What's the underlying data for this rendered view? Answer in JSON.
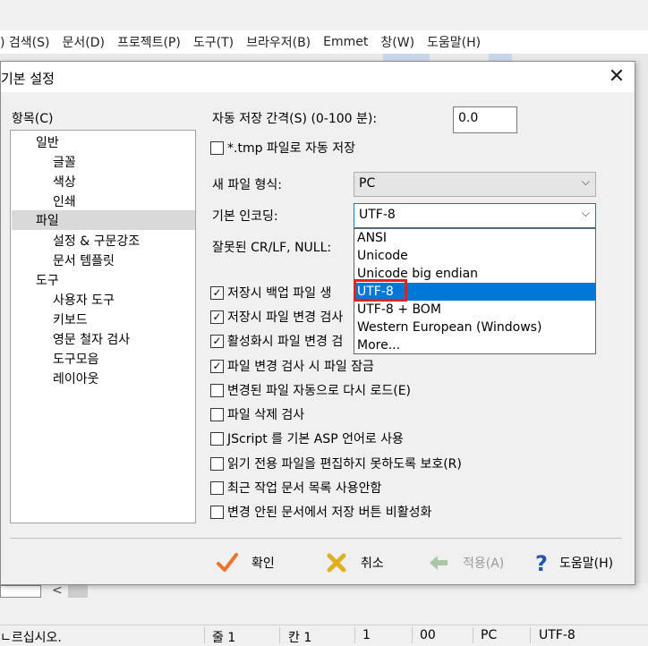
{
  "menu": [
    ") 검색(S)",
    "문서(D)",
    "프로젝트(P)",
    "도구(T)",
    "브라우저(B)",
    "Emmet",
    "창(W)",
    "도움말(H)"
  ],
  "dialog": {
    "title": "기본 설정",
    "close_glyph": "✕",
    "tree_label": "항목(C)",
    "tree": [
      {
        "label": "일반",
        "level": 1
      },
      {
        "label": "글꼴",
        "level": 2
      },
      {
        "label": "색상",
        "level": 2
      },
      {
        "label": "인쇄",
        "level": 2
      },
      {
        "label": "파일",
        "level": 1,
        "selected": true
      },
      {
        "label": "설정 & 구문강조",
        "level": 2
      },
      {
        "label": "문서 템플릿",
        "level": 2
      },
      {
        "label": "도구",
        "level": 1
      },
      {
        "label": "사용자 도구",
        "level": 2
      },
      {
        "label": "키보드",
        "level": 2
      },
      {
        "label": "영문 철자 검사",
        "level": 2
      },
      {
        "label": "도구모음",
        "level": 2
      },
      {
        "label": "레이아웃",
        "level": 2
      }
    ],
    "autosave_label": "자동 저장 간격(S) (0-100 분):",
    "autosave_value": "0.0",
    "tmp_autosave_label": "*.tmp 파일로 자동 저장",
    "new_file_format_label": "새 파일 형식:",
    "new_file_format_value": "PC",
    "encoding_label": "기본 인코딩:",
    "encoding_value": "UTF-8",
    "crlf_label": "잘못된 CR/LF, NULL:",
    "encoding_options": [
      {
        "label": "ANSI"
      },
      {
        "label": "Unicode"
      },
      {
        "label": "Unicode big endian"
      },
      {
        "label": "UTF-8",
        "highlighted": true
      },
      {
        "label": "UTF-8 + BOM"
      },
      {
        "label": "Western European (Windows)"
      },
      {
        "label": "More..."
      }
    ],
    "checkboxes": [
      {
        "label": "저장시 백업 파일 생",
        "checked": true
      },
      {
        "label": "저장시 파일 변경 검사",
        "checked": true
      },
      {
        "label": "활성화시 파일 변경 검",
        "checked": true
      },
      {
        "label": "파일 변경 검사 시 파일 잠금",
        "checked": true
      },
      {
        "label": "변경된 파일 자동으로 다시 로드(E)",
        "checked": false
      },
      {
        "label": "파일 삭제 검사",
        "checked": false
      },
      {
        "label": "JScript 를 기본 ASP 언어로 사용",
        "checked": false
      },
      {
        "label": "읽기 전용 파일을 편집하지 못하도록 보호(R)",
        "checked": false
      },
      {
        "label": "최근 작업 문서 목록 사용안함",
        "checked": false
      },
      {
        "label": "변경 안된 문서에서 저장 버튼 비활성화",
        "checked": false
      }
    ],
    "buttons": {
      "ok": "확인",
      "cancel": "취소",
      "apply": "적용(A)",
      "help": "도움말(H)"
    },
    "colors": {
      "accent": "#0078d7",
      "highlight_box": "#e2231a",
      "ok_icon": "#e8742a",
      "cancel_icon": "#e0b020",
      "apply_icon": "#a8c8a8",
      "help_icon": "#2456b0"
    }
  },
  "statusbar": {
    "hint": "ㄴ르십시오.",
    "line": "줄 1",
    "col": "칸 1",
    "n1": "1",
    "n2": "00",
    "format": "PC",
    "encoding": "UTF-8"
  },
  "scroll_arrow": "<"
}
